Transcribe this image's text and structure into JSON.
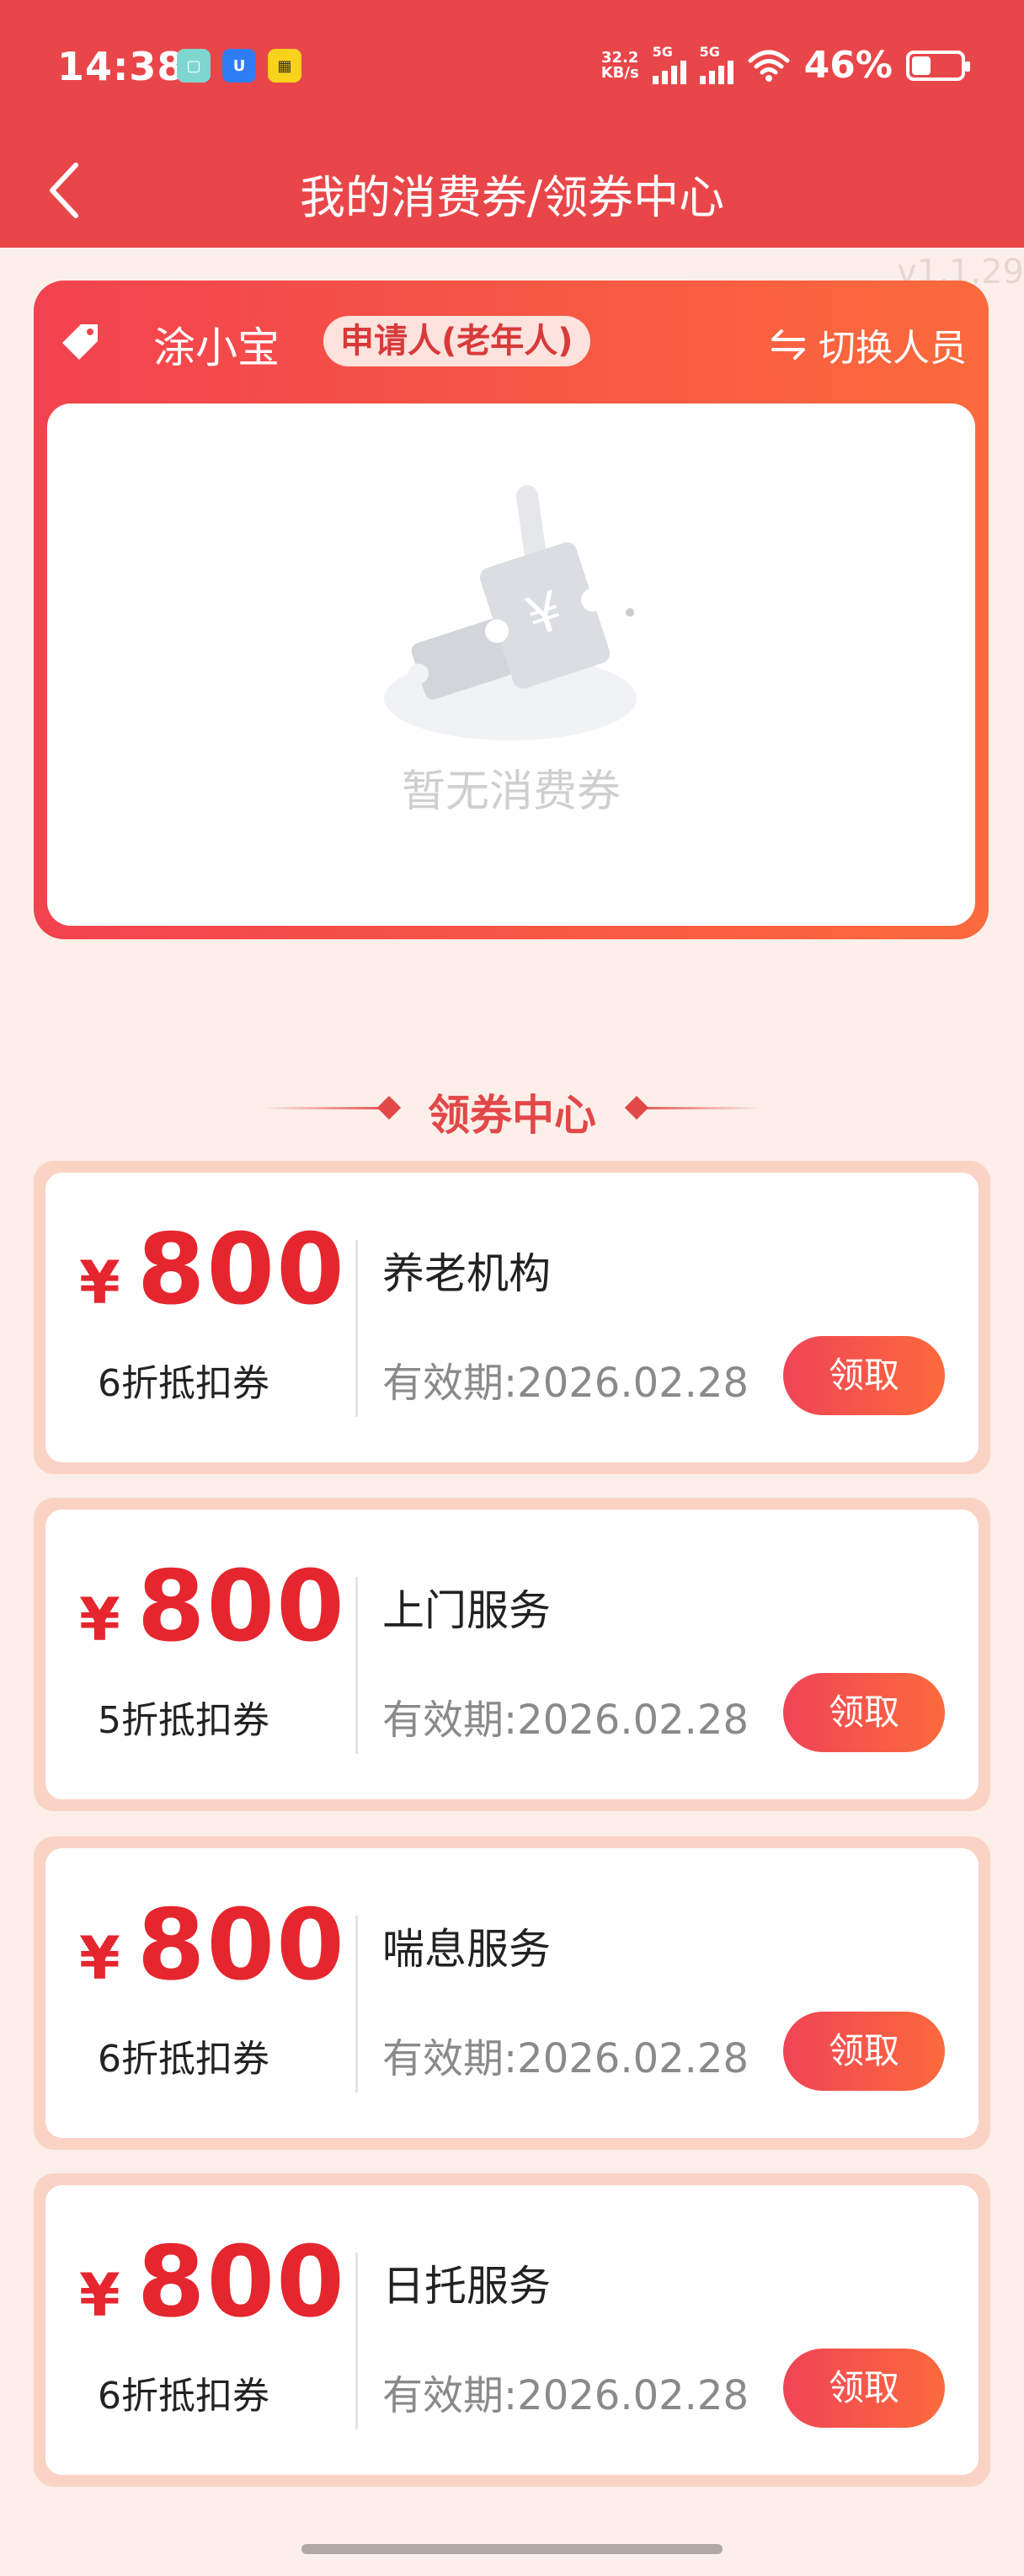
{
  "status_bar": {
    "time": "14:38",
    "net_speed_value": "32.2",
    "net_speed_unit": "KB/s",
    "signal_1_label": "5G",
    "signal_2_label": "5G",
    "battery_percent": "46%",
    "app_icons": [
      "app-icon-teal",
      "app-icon-blue",
      "app-icon-yellow"
    ]
  },
  "nav": {
    "title": "我的消费券/领券中心"
  },
  "version": "v1.1.29",
  "user_card": {
    "name": "涂小宝",
    "role": "申请人(老年人)",
    "switch_label": "切换人员",
    "empty_text": "暂无消费券"
  },
  "section": {
    "title": "领券中心"
  },
  "coupons": [
    {
      "currency": "¥",
      "amount": "800",
      "discount": "6折抵扣券",
      "type": "养老机构",
      "valid": "有效期:2026.02.28",
      "button": "领取"
    },
    {
      "currency": "¥",
      "amount": "800",
      "discount": "5折抵扣券",
      "type": "上门服务",
      "valid": "有效期:2026.02.28",
      "button": "领取"
    },
    {
      "currency": "¥",
      "amount": "800",
      "discount": "6折抵扣券",
      "type": "喘息服务",
      "valid": "有效期:2026.02.28",
      "button": "领取"
    },
    {
      "currency": "¥",
      "amount": "800",
      "discount": "6折抵扣券",
      "type": "日托服务",
      "valid": "有效期:2026.02.28",
      "button": "领取"
    }
  ],
  "colors": {
    "header_red": "#e9464a",
    "accent_red": "#e5262e",
    "page_bg": "#fcefe9",
    "coupon_border": "#fad3c5"
  }
}
